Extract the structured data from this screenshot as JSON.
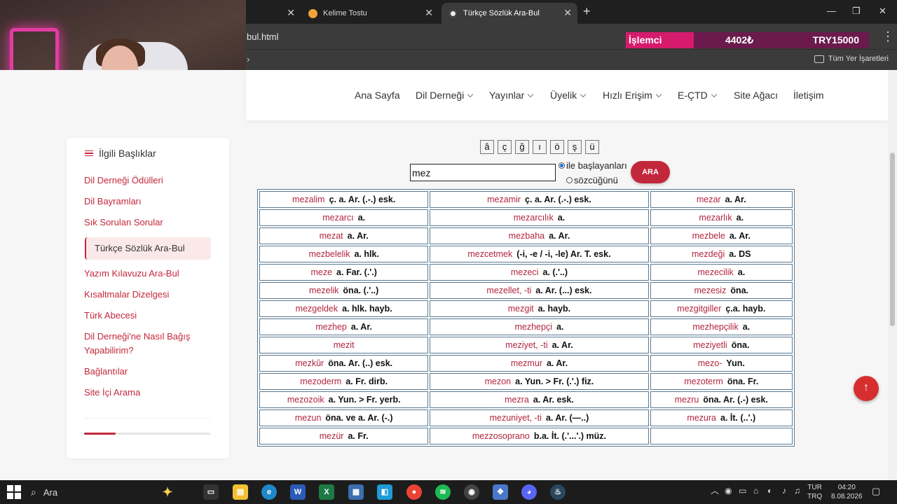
{
  "browser": {
    "tabs": [
      {
        "label": "Kelime Tostu"
      },
      {
        "label": "Türkçe Sözlük Ara-Bul"
      }
    ],
    "url": "bul.html",
    "bookmarks_label": "Tüm Yer İşaretleri"
  },
  "ticker": {
    "name": "İşlemci",
    "value": "4402₺",
    "total": "TRY15000"
  },
  "nav": {
    "items": [
      {
        "label": "Ana Sayfa",
        "dropdown": false
      },
      {
        "label": "Dil Derneği",
        "dropdown": true
      },
      {
        "label": "Yayınlar",
        "dropdown": true
      },
      {
        "label": "Üyelik",
        "dropdown": true
      },
      {
        "label": "Hızlı Erişim",
        "dropdown": true
      },
      {
        "label": "E-ÇTD",
        "dropdown": true
      },
      {
        "label": "Site Ağacı",
        "dropdown": false
      },
      {
        "label": "İletişim",
        "dropdown": false
      }
    ]
  },
  "sidebar": {
    "title": "İlgili Başlıklar",
    "items": [
      "Dil Derneği Ödülleri",
      "Dil Bayramları",
      "Sık Sorulan Sorular",
      "Türkçe Sözlük Ara-Bul",
      "Yazım Kılavuzu Ara-Bul",
      "Kısaltmalar Dizelgesi",
      "Türk Abecesi",
      "Dil Derneği'ne Nasıl Bağış Yapabilirim?",
      "Bağlantılar",
      "Site İçi Arama"
    ],
    "active_index": 3,
    "progress": 0.25
  },
  "search": {
    "chars": [
      "â",
      "ç",
      "ğ",
      "ı",
      "ö",
      "ş",
      "ü"
    ],
    "value": "mez",
    "option_starts": "ile başlayanları",
    "option_word": "sözcüğünü",
    "selected_option": "ile başlayanları",
    "button": "ARA"
  },
  "results": [
    [
      {
        "w": "mezalim",
        "d": "ç. a. Ar. (.-.) esk."
      },
      {
        "w": "mezamir",
        "d": "ç. a. Ar. (.-.) esk."
      },
      {
        "w": "mezar",
        "d": "a. Ar."
      }
    ],
    [
      {
        "w": "mezarcı",
        "d": "a."
      },
      {
        "w": "mezarcılık",
        "d": "a."
      },
      {
        "w": "mezarlık",
        "d": "a."
      }
    ],
    [
      {
        "w": "mezat",
        "d": "a. Ar."
      },
      {
        "w": "mezbaha",
        "d": "a. Ar."
      },
      {
        "w": "mezbele",
        "d": "a. Ar."
      }
    ],
    [
      {
        "w": "mezbelelik",
        "d": "a. hlk."
      },
      {
        "w": "mezcetmek",
        "d": "(-i, -e / -i, -le) Ar. T. esk."
      },
      {
        "w": "mezdeği",
        "d": "a. DS"
      }
    ],
    [
      {
        "w": "meze",
        "d": "a. Far. (.'.)"
      },
      {
        "w": "mezeci",
        "d": "a. (.'..)"
      },
      {
        "w": "mezecilik",
        "d": "a."
      }
    ],
    [
      {
        "w": "mezelik",
        "d": "öna. (.'..)"
      },
      {
        "w": "mezellet, -ti",
        "d": "a. Ar. (...) esk."
      },
      {
        "w": "mezesiz",
        "d": "öna."
      }
    ],
    [
      {
        "w": "mezgeldek",
        "d": "a. hlk. hayb."
      },
      {
        "w": "mezgit",
        "d": "a. hayb."
      },
      {
        "w": "mezgitgiller",
        "d": "ç.a. hayb."
      }
    ],
    [
      {
        "w": "mezhep",
        "d": "a. Ar."
      },
      {
        "w": "mezhepçi",
        "d": "a."
      },
      {
        "w": "mezhepçilik",
        "d": "a."
      }
    ],
    [
      {
        "w": "mezit",
        "d": ""
      },
      {
        "w": "meziyet, -ti",
        "d": "a. Ar."
      },
      {
        "w": "meziyetli",
        "d": "öna."
      }
    ],
    [
      {
        "w": "mezkûr",
        "d": "öna. Ar. (..) esk."
      },
      {
        "w": "mezmur",
        "d": "a. Ar."
      },
      {
        "w": "mezo-",
        "d": "Yun."
      }
    ],
    [
      {
        "w": "mezoderm",
        "d": "a. Fr. dirb."
      },
      {
        "w": "mezon",
        "d": "a. Yun. > Fr. (.'.) fiz."
      },
      {
        "w": "mezoterm",
        "d": "öna. Fr."
      }
    ],
    [
      {
        "w": "mezozoik",
        "d": "a. Yun. > Fr. yerb."
      },
      {
        "w": "mezra",
        "d": "a. Ar. esk."
      },
      {
        "w": "mezru",
        "d": "öna. Ar. (.-) esk."
      }
    ],
    [
      {
        "w": "mezun",
        "d": "öna. ve a. Ar. (-.)"
      },
      {
        "w": "mezuniyet, -ti",
        "d": "a. Ar. (—..)"
      },
      {
        "w": "mezura",
        "d": "a. İt. (..'.)"
      }
    ],
    [
      {
        "w": "mezür",
        "d": "a. Fr."
      },
      {
        "w": "mezzosoprano",
        "d": "b.a. İt. (.'...'.) müz."
      },
      {
        "w": "",
        "d": ""
      }
    ]
  ],
  "taskbar": {
    "search_label": "Ara",
    "lang_top": "TUR",
    "lang_bottom": "TRQ",
    "time": "04:20",
    "date": "8.08.2026"
  },
  "colors": {
    "accent": "#c3273b",
    "table_border": "#5a7a92"
  }
}
